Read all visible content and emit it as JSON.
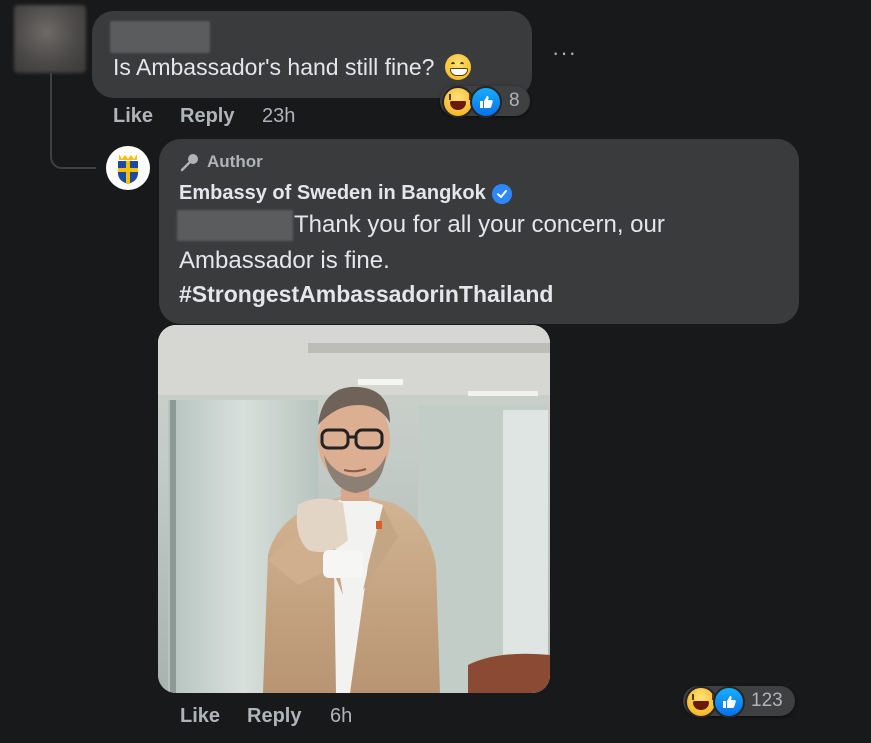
{
  "top_comment": {
    "text": "Is Ambassador's hand still fine?",
    "emoji": "grinning-face-icon",
    "reaction_count": "8",
    "like_label": "Like",
    "reply_label": "Reply",
    "time": "23h",
    "more": "···"
  },
  "reply": {
    "badge": "Author",
    "author": "Embassy of Sweden in Bangkok",
    "line1": "Thank you for all your concern, our",
    "line2": "Ambassador is fine.",
    "hashtag": "#StrongestAmbassadorinThailand",
    "reaction_count": "123",
    "like_label": "Like",
    "reply_label": "Reply",
    "time": "6h"
  },
  "colors": {
    "background": "#18191a",
    "bubble": "#3a3b3c",
    "text": "#e4e6eb",
    "secondary": "#b0b3b8",
    "verified": "#2d88ff",
    "like_blue": "#1877f2",
    "haha_yellow": "#f7b928"
  }
}
